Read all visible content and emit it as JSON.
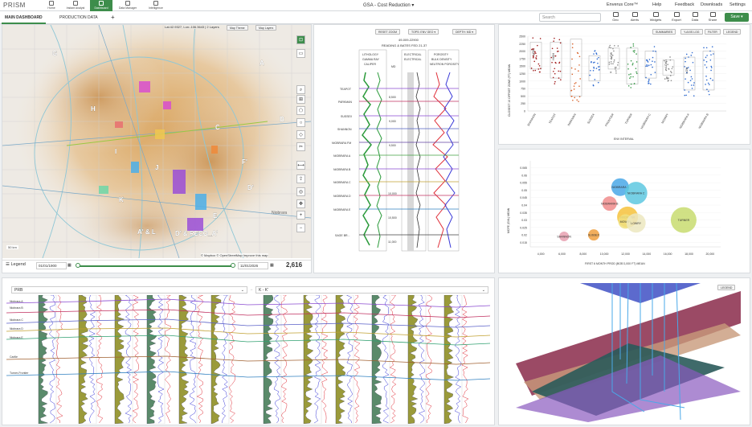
{
  "app": {
    "name": "PRISM",
    "title": "GSA - Cost Reduction"
  },
  "nav": [
    {
      "label": "Home"
    },
    {
      "label": "Instant Analyst"
    },
    {
      "label": "Dashboard"
    },
    {
      "label": "Data Manager"
    },
    {
      "label": "Intelligence"
    }
  ],
  "top_links": {
    "core": "Enverus Core™",
    "help": "Help",
    "feedback": "Feedback",
    "downloads": "Downloads",
    "settings": "Settings"
  },
  "tabs": [
    {
      "label": "MAIN DASHBOARD"
    },
    {
      "label": "PRODUCTION DATA"
    }
  ],
  "search": {
    "placeholder": "Search"
  },
  "toolbar": {
    "alerts": "Alerts",
    "widgets": "Widgets",
    "export": "Export",
    "data": "Data",
    "share": "Share",
    "save": "Save",
    "geo": "Geo"
  },
  "map": {
    "coords": "Lat:42.9327, Lon:-106.3643 | 2 Layers",
    "map_theme": "Map Theme",
    "map_layers": "Map Layers",
    "attribution": "© Mapbox © OpenStreetMap  Improve this map",
    "scale": "50 km",
    "labels": [
      "G",
      "H",
      "I",
      "J",
      "K",
      "A",
      "D'",
      "B",
      "C",
      "E",
      "F'"
    ],
    "section_labels": [
      "A' & L",
      "D' & RECO_A'"
    ],
    "place": "Niobrara",
    "legend": "Legend",
    "date_start": "01/01/1900",
    "date_end": "11/01/2026",
    "count": "2,616"
  },
  "log": {
    "reset_zoom": "RESET ZOOM",
    "tops": "TOPS: ENV GEO",
    "depth": "DEPTH: MD",
    "well_id": "49-009-22900",
    "well_name": "READING & BATES FED 21-37",
    "tracks": [
      "LITHOLOGY",
      "ELECTRICAL",
      "POROSITY"
    ],
    "curves": [
      "GAMMA RAY",
      "CALIPER",
      "ELECTRICAL",
      "BULK DENSITY",
      "NEUTRON POROSITY"
    ],
    "md": "MD",
    "tops_list": [
      "TEAPOT",
      "PARKMAN",
      "SUSSEX",
      "SHANNON",
      "NIOBRARA FM",
      "NIOBRARA A",
      "NIOBRARA B",
      "NIOBRARA C",
      "NIOBRARA D",
      "NIOBRARA E",
      "SAGE BR..."
    ],
    "depth_ticks": [
      "8,500",
      "9,000",
      "9,500",
      "10,000",
      "10,500",
      "11,000"
    ]
  },
  "box": {
    "buttons": [
      "SUMMARIES",
      "Y-AXIS LOG",
      "FILTER",
      "LEGEND"
    ],
    "ylabel": "CLOSEST 10 OFFSET ZONE (FT) MEAN",
    "xlabel": "ENV INTERVAL",
    "yticks": [
      "0",
      "250",
      "500",
      "750",
      "1000",
      "1250",
      "1500",
      "1750",
      "2000",
      "2250",
      "2500"
    ],
    "cats": [
      "SHANNON",
      "TEAPOT",
      "PARKMAN",
      "SUSSEX",
      "FRONTIER",
      "TURNER",
      "NIOBRARA C",
      "MOWRY",
      "NIOBRARA A",
      "NIOBRARA B"
    ],
    "box_labels": [
      "LOW",
      "HIGH",
      "LOW",
      "LOW",
      "LOW"
    ]
  },
  "bubble": {
    "ylabel": "MCFE (GVL) MEAN",
    "xlabel": "FIRST 6 MONTH PROD (BOE/1,000 FT) MEAN",
    "xticks": [
      "4,000",
      "6,000",
      "8,000",
      "10,000",
      "12,000",
      "14,000",
      "16,000",
      "18,000",
      "20,000"
    ],
    "yticks": [
      "0.015",
      "0.02",
      "0.025",
      "0.03",
      "0.035",
      "0.04",
      "0.045",
      "0.05",
      "0.055",
      "0.06",
      "0.065"
    ],
    "points": [
      {
        "label": "NIOBRARA A",
        "x": 11500,
        "y": 0.052,
        "c": "#4aa8e8"
      },
      {
        "label": "NIOBRARA C",
        "x": 13000,
        "y": 0.048,
        "c": "#5ec8e0"
      },
      {
        "label": "NIOBRARA B",
        "x": 10500,
        "y": 0.041,
        "c": "#f08c8c"
      },
      {
        "label": "FRONTIER",
        "x": 12200,
        "y": 0.032,
        "c": "#f6c23c"
      },
      {
        "label": "MOWRY",
        "x": 12000,
        "y": 0.029,
        "c": "#f0e080"
      },
      {
        "label": "TURNER",
        "x": 17500,
        "y": 0.03,
        "c": "#c8dc70"
      },
      {
        "label": "LOWRY",
        "x": 13000,
        "y": 0.028,
        "c": "#ece8c0"
      },
      {
        "label": "SHANNON",
        "x": 6200,
        "y": 0.019,
        "c": "#e8a0b0"
      },
      {
        "label": "SUSSEX",
        "x": 9000,
        "y": 0.02,
        "c": "#f0a040"
      }
    ]
  },
  "xsection": {
    "basin": "PRB",
    "line": "K - K'",
    "tops": [
      "Niobrara A",
      "Niobrara B",
      "Niobrara C",
      "Niobrara D",
      "Niobrara E",
      "Carlile",
      "Turner-Frontier"
    ]
  },
  "threed": {
    "legend": "LEGEND"
  }
}
